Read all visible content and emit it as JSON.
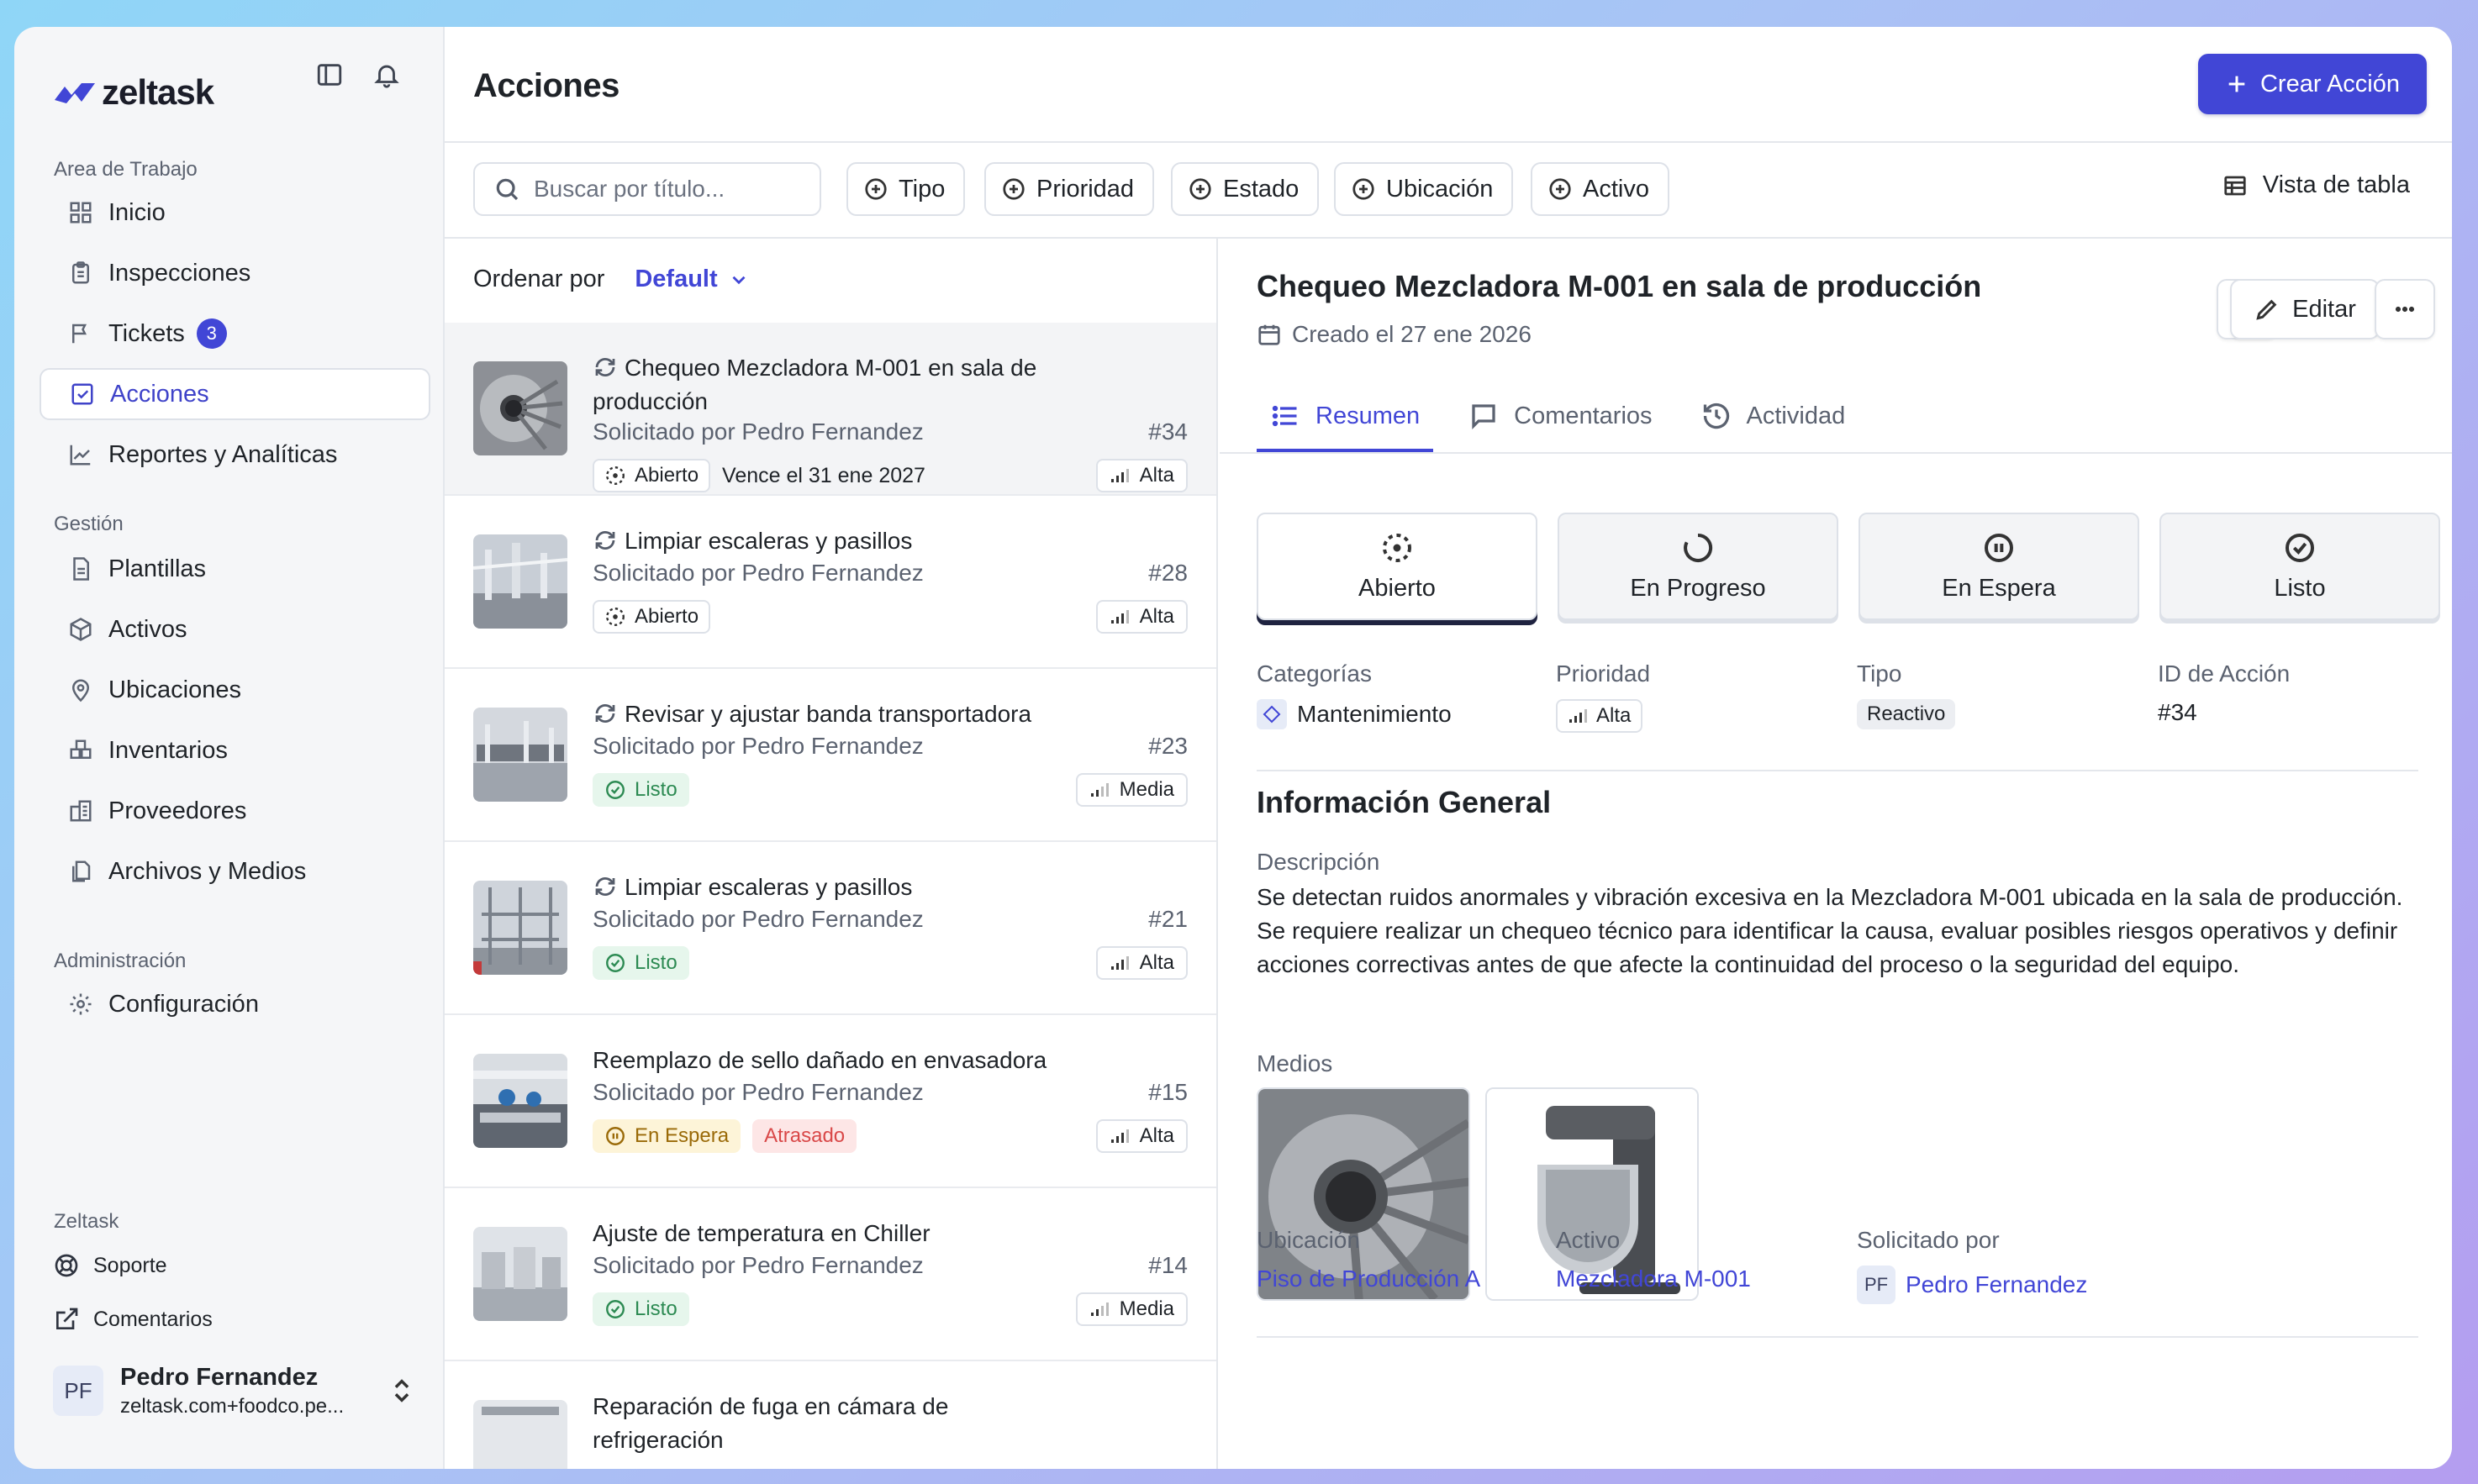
{
  "app": {
    "name": "zeltask",
    "brand_color": "#4146d6"
  },
  "sidebar": {
    "workspace_label": "Area de Trabajo",
    "workspace_items": [
      {
        "label": "Inicio",
        "icon": "dashboard-icon"
      },
      {
        "label": "Inspecciones",
        "icon": "clipboard-icon"
      },
      {
        "label": "Tickets",
        "icon": "flag-icon",
        "badge": "3"
      },
      {
        "label": "Acciones",
        "icon": "checkbox-icon",
        "active": true
      },
      {
        "label": "Reportes y Analíticas",
        "icon": "chart-icon"
      }
    ],
    "management_label": "Gestión",
    "management_items": [
      {
        "label": "Plantillas",
        "icon": "template-icon"
      },
      {
        "label": "Activos",
        "icon": "box-icon"
      },
      {
        "label": "Ubicaciones",
        "icon": "location-pin-icon"
      },
      {
        "label": "Inventarios",
        "icon": "inventory-icon"
      },
      {
        "label": "Proveedores",
        "icon": "building-icon"
      },
      {
        "label": "Archivos y Medios",
        "icon": "files-icon"
      }
    ],
    "admin_label": "Administración",
    "admin_items": [
      {
        "label": "Configuración",
        "icon": "gear-icon"
      }
    ],
    "footer_label": "Zeltask",
    "footer_items": [
      {
        "label": "Soporte",
        "icon": "lifebuoy-icon"
      },
      {
        "label": "Comentarios",
        "icon": "external-feedback-icon"
      }
    ],
    "user": {
      "initials": "PF",
      "name": "Pedro Fernandez",
      "email": "zeltask.com+foodco.pe..."
    }
  },
  "header": {
    "title": "Acciones",
    "create_label": "Crear Acción"
  },
  "filters": {
    "search_placeholder": "Buscar por título...",
    "chips": [
      "Tipo",
      "Prioridad",
      "Estado",
      "Ubicación",
      "Activo"
    ],
    "table_view_label": "Vista de tabla"
  },
  "list": {
    "sort_label": "Ordenar por",
    "sort_value": "Default",
    "items": [
      {
        "title": "Chequeo Mezcladora M-001 en sala de producción",
        "requested": "Solicitado por Pedro Fernandez",
        "number": "#34",
        "status": "Abierto",
        "status_kind": "open",
        "due": "Vence el 31 ene 2027",
        "priority": "Alta",
        "recurring": true
      },
      {
        "title": "Limpiar escaleras y pasillos",
        "requested": "Solicitado por Pedro Fernandez",
        "number": "#28",
        "status": "Abierto",
        "status_kind": "open",
        "priority": "Alta",
        "recurring": true
      },
      {
        "title": "Revisar y ajustar banda transportadora",
        "requested": "Solicitado por Pedro Fernandez",
        "number": "#23",
        "status": "Listo",
        "status_kind": "done",
        "priority": "Media",
        "recurring": true
      },
      {
        "title": "Limpiar escaleras y pasillos",
        "requested": "Solicitado por Pedro Fernandez",
        "number": "#21",
        "status": "Listo",
        "status_kind": "done",
        "priority": "Alta",
        "recurring": true
      },
      {
        "title": "Reemplazo de sello dañado en envasadora",
        "requested": "Solicitado por Pedro Fernandez",
        "number": "#15",
        "status": "En Espera",
        "status_kind": "hold",
        "extra": "Atrasado",
        "priority": "Alta",
        "recurring": false
      },
      {
        "title": "Ajuste de temperatura en Chiller",
        "requested": "Solicitado por Pedro Fernandez",
        "number": "#14",
        "status": "Listo",
        "status_kind": "done",
        "priority": "Media",
        "recurring": false
      },
      {
        "title": "Reparación de fuga en cámara de refrigeración",
        "recurring": false
      }
    ]
  },
  "detail": {
    "title": "Chequeo Mezcladora M-001 en sala de producción",
    "created": "Creado el 27 ene 2026",
    "edit_label": "Editar",
    "tabs": [
      "Resumen",
      "Comentarios",
      "Actividad"
    ],
    "states": [
      "Abierto",
      "En Progreso",
      "En Espera",
      "Listo"
    ],
    "active_state": "Abierto",
    "categories_label": "Categorías",
    "category": "Mantenimiento",
    "priority_label": "Prioridad",
    "priority": "Alta",
    "type_label": "Tipo",
    "type": "Reactivo",
    "id_label": "ID de Acción",
    "id": "#34",
    "section_title": "Información General",
    "description_label": "Descripción",
    "description": "Se detectan ruidos anormales y vibración excesiva en la Mezcladora M-001 ubicada en la sala de producción. Se requiere realizar un chequeo técnico para identificar la causa, evaluar posibles riesgos operativos y definir acciones correctivas antes de que afecte la continuidad del proceso o la seguridad del equipo.",
    "media_label": "Medios",
    "location_label": "Ubicación",
    "location": "Piso de Producción A",
    "asset_label": "Activo",
    "asset": "Mezcladora M-001",
    "requested_label": "Solicitado por",
    "requested_initials": "PF",
    "requested_by": "Pedro Fernandez"
  }
}
